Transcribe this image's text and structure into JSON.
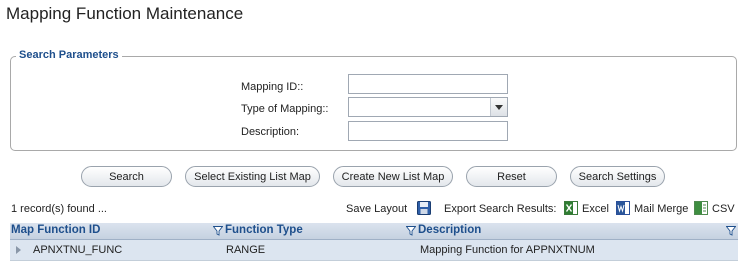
{
  "page": {
    "title": "Mapping Function Maintenance"
  },
  "search_parameters": {
    "legend": "Search Parameters",
    "fields": {
      "mapping_id": {
        "label": "Mapping ID::",
        "value": ""
      },
      "type_of_mapping": {
        "label": "Type of Mapping::",
        "value": ""
      },
      "description": {
        "label": "Description:",
        "value": ""
      }
    }
  },
  "buttons": {
    "search": "Search",
    "select_existing_list_map": "Select Existing List Map",
    "create_new_list_map": "Create New List Map",
    "reset": "Reset",
    "search_settings": "Search Settings"
  },
  "results": {
    "count_text": "1 record(s) found ...",
    "save_layout": "Save Layout",
    "export_label": "Export Search Results:",
    "export_excel": "Excel",
    "export_mail_merge": "Mail Merge",
    "export_csv": "CSV"
  },
  "grid": {
    "columns": [
      "Map Function ID",
      "Function Type",
      "Description"
    ],
    "rows": [
      {
        "map_function_id": "APNXTNU_FUNC",
        "function_type": "RANGE",
        "description": "Mapping Function for APPNXTNUM"
      }
    ]
  },
  "colors": {
    "accent": "#1e4f8c",
    "header_bg": "#c5d1e0",
    "row_bg": "#dce5f0"
  },
  "icons": [
    "save-layout-icon",
    "excel-icon",
    "word-icon",
    "csv-icon",
    "filter-icon",
    "expand-row-icon",
    "chevron-down-icon"
  ]
}
